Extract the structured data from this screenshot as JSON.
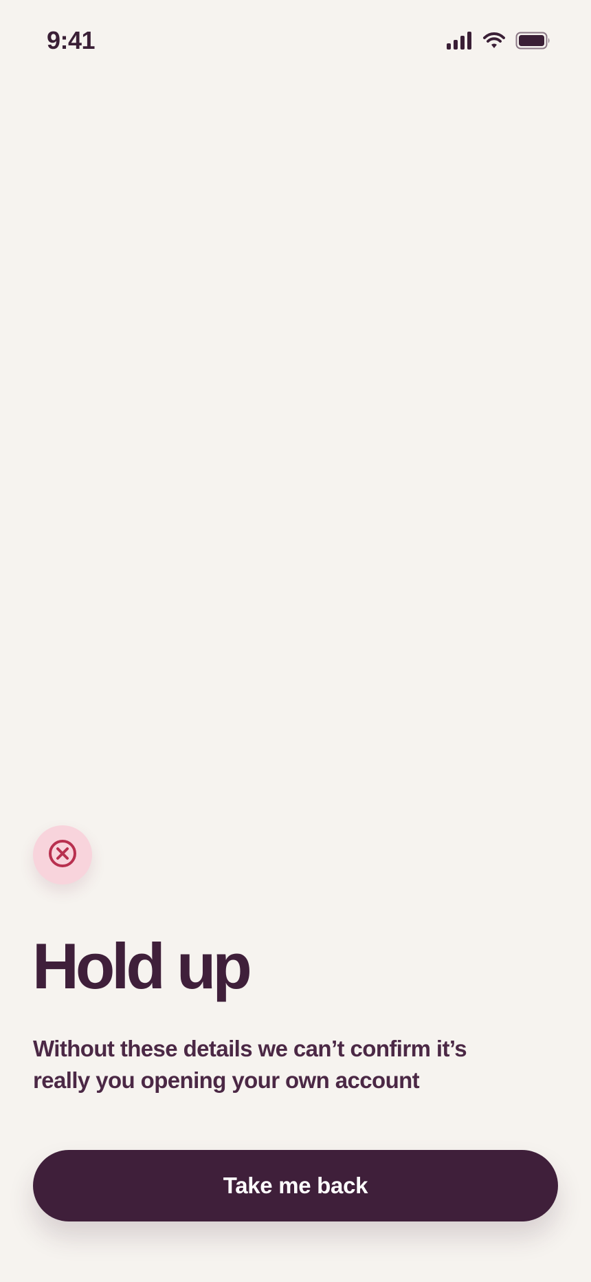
{
  "status_bar": {
    "time": "9:41",
    "icons": [
      "cellular-signal-icon",
      "wifi-icon",
      "battery-icon"
    ]
  },
  "badge": {
    "icon": "close-circle-icon",
    "colors": {
      "background": "#f8d4dc",
      "icon": "#b8304f"
    }
  },
  "content": {
    "title": "Hold up",
    "message": "Without these details we can’t confirm it’s really you opening your own account"
  },
  "actions": {
    "primary_label": "Take me back"
  },
  "colors": {
    "background": "#f6f3ef",
    "text": "#3f1f3a",
    "button": "#3f1f3a",
    "button_text": "#ffffff"
  }
}
